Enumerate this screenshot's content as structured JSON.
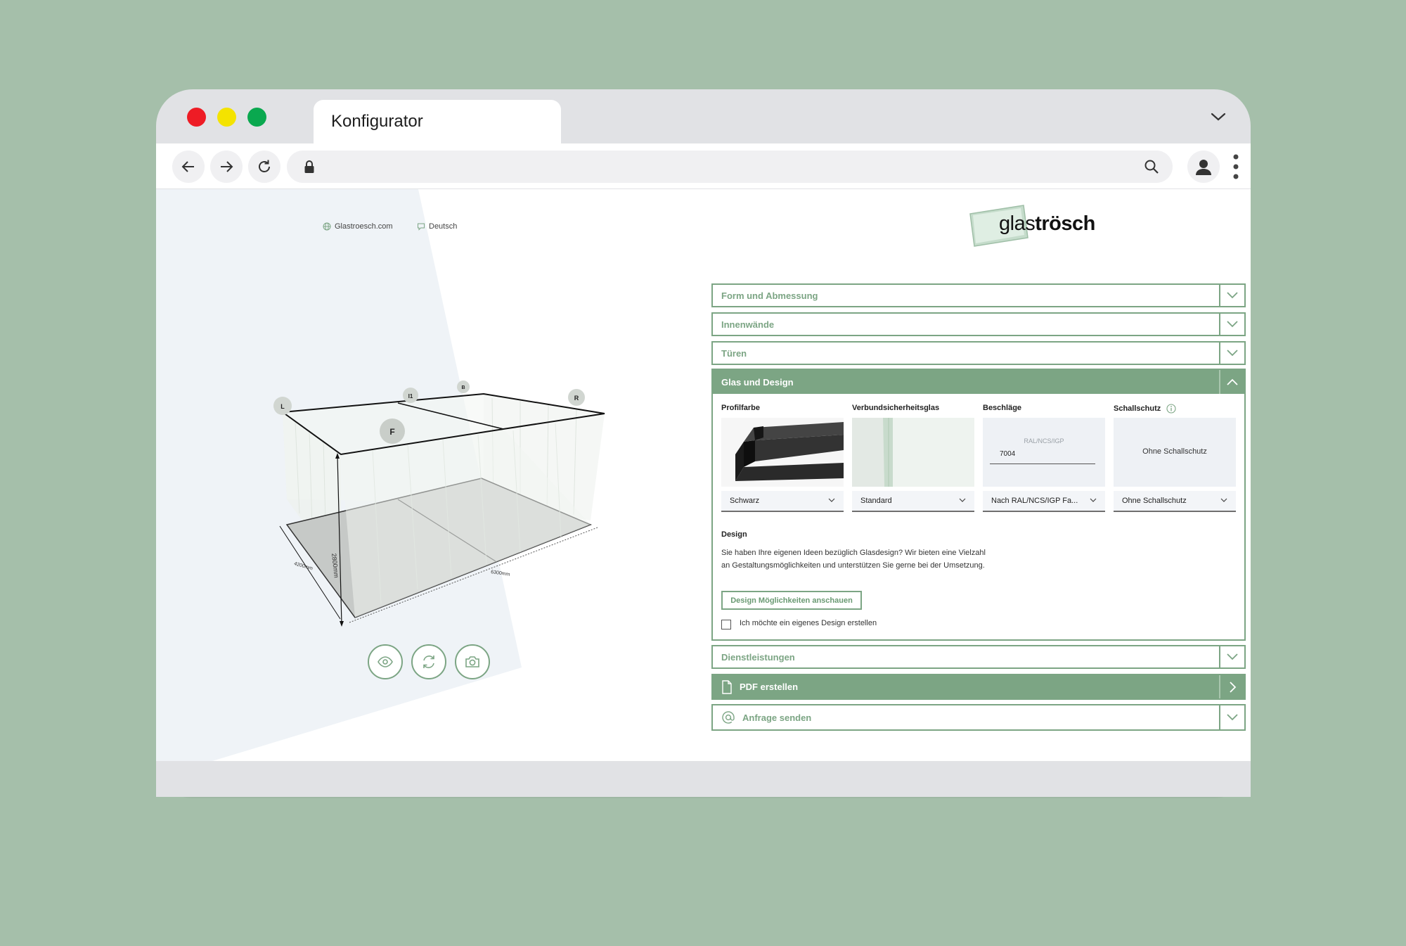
{
  "browser": {
    "tab_title": "Konfigurator",
    "traffic_lights": {
      "close": "#ee1c25",
      "minimize": "#f4e300",
      "maximize": "#0aa84f"
    }
  },
  "header": {
    "website_link": "Glastroesch.com",
    "language": "Deutsch",
    "logo": {
      "prefix": "glas",
      "suffix": "trösch"
    }
  },
  "viewer": {
    "wall_labels": [
      "L",
      "I1",
      "B",
      "R",
      "F"
    ],
    "dimensions": {
      "depth": "4200mm",
      "height": "2800mm",
      "width": "6300mm"
    },
    "controls": [
      "eye-icon",
      "refresh-icon",
      "camera-icon"
    ]
  },
  "accordion": {
    "sections": [
      "Form und Abmessung",
      "Innenwände",
      "Türen"
    ],
    "open_section": "Glas und Design",
    "options": [
      {
        "label": "Profilfarbe",
        "selected": "Schwarz"
      },
      {
        "label": "Verbundsicherheitsglas",
        "selected": "Standard"
      },
      {
        "label": "Beschläge",
        "field_caption": "RAL/NCS/IGP",
        "field_value": "7004",
        "selected": "Nach RAL/NCS/IGP Fa..."
      },
      {
        "label": "Schallschutz",
        "tile_text": "Ohne Schallschutz",
        "selected": "Ohne Schallschutz"
      }
    ],
    "design": {
      "title": "Design",
      "text": "Sie haben Ihre eigenen Ideen bezüglich Glasdesign? Wir bieten eine Vielzahl an Gestaltungsmöglichkeiten und unterstützen Sie gerne bei der Umsetzung.",
      "button": "Design Möglichkeiten anschauen",
      "checkbox_label": "Ich möchte ein eigenes Design erstellen",
      "checkbox_checked": false
    },
    "after_sections": {
      "services": "Dienstleistungen",
      "pdf": "PDF erstellen",
      "request": "Anfrage senden"
    }
  },
  "colors": {
    "accent": "#7ca584",
    "background": "#a5bfaa"
  }
}
